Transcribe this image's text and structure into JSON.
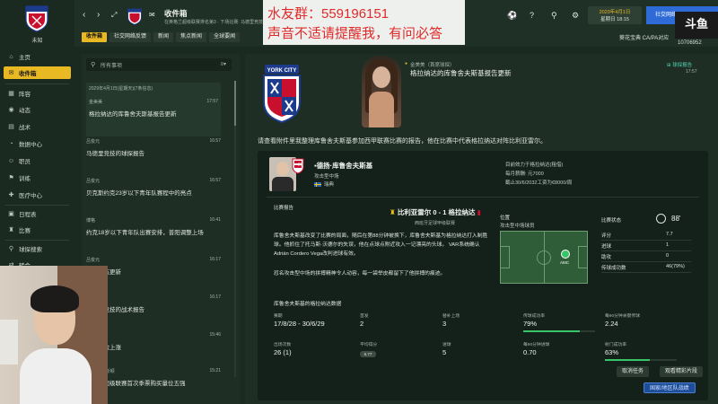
{
  "club": {
    "label": "未知",
    "badge_text": "YORK CITY"
  },
  "sidebar": {
    "items": [
      {
        "label": "主页",
        "icon": "home-icon",
        "glyph": "⌂"
      },
      {
        "label": "收件箱",
        "icon": "inbox-icon",
        "glyph": "✉"
      },
      {
        "label": "阵容",
        "icon": "squad-icon",
        "glyph": "▦"
      },
      {
        "label": "动态",
        "icon": "dynamics-icon",
        "glyph": "◉"
      },
      {
        "label": "战术",
        "icon": "tactics-icon",
        "glyph": "▤"
      },
      {
        "label": "数据中心",
        "icon": "data-hub-icon",
        "glyph": "◔"
      },
      {
        "label": "职员",
        "icon": "staff-icon",
        "glyph": "☺"
      },
      {
        "label": "训练",
        "icon": "training-icon",
        "glyph": "⚑"
      },
      {
        "label": "医疗中心",
        "icon": "medical-icon",
        "glyph": "✚"
      },
      {
        "label": "日程表",
        "icon": "schedule-icon",
        "glyph": "▣"
      },
      {
        "label": "比赛",
        "icon": "competitions-icon",
        "glyph": "♜"
      },
      {
        "label": "球探搜索",
        "icon": "scouting-icon",
        "glyph": "⚲"
      },
      {
        "label": "转会",
        "icon": "transfers-icon",
        "glyph": "⇄"
      }
    ]
  },
  "topbar": {
    "title": "收件箱",
    "subtitle": "在英格兰超级联赛排名第3 · 下场比赛: 马德里竞技(主场)",
    "tabs": [
      "收件箱",
      "社交网络反馈",
      "新闻",
      "焦点新闻",
      "全球要闻"
    ],
    "date_line1": "2029年4月1日",
    "date_line2": "星期日 18:15",
    "continue_label": "社交网络",
    "ad_text": "葵花宝典 CA/PA对应",
    "logo_text": "斗鱼",
    "room_id": "10706952"
  },
  "overlay": {
    "line1": "水友群：559196151",
    "line2": "声音不适请提醒我，有问必答"
  },
  "inbox": {
    "search_placeholder": "所有事项",
    "date_header": "2029年4月1日(星期天)(7条信息)",
    "messages": [
      {
        "from": "金美美",
        "time": "17:57",
        "subject": "格拉纳达的库鲁舍夫斯基报告更新"
      },
      {
        "from": "吕俊元",
        "time": "16:57",
        "subject": "马德里竞技的球探报告"
      },
      {
        "from": "吕俊元",
        "time": "16:57",
        "subject": "贝克斯约克23岁以下青年队赛程中的亮点"
      },
      {
        "from": "博格",
        "time": "16:41",
        "subject": "约克18岁以下青年队出赛安排，普阳调整上场"
      },
      {
        "from": "吕俊元",
        "time": "16:17",
        "subject": "球队动态更新"
      },
      {
        "from": "吕俊元",
        "time": "16:17",
        "subject": "马德里竞技的战术报告"
      },
      {
        "from": "吕俊元",
        "time": "15:46",
        "subject": "比赛奖金上涨"
      },
      {
        "from": "奥布里·费斯顿",
        "time": "15:21",
        "subject": "英格兰超级联赛首次季票购买量位五强"
      }
    ]
  },
  "message": {
    "sender": "金美美（首席球探）",
    "headline": "格拉纳达的库鲁舍夫斯基报告更新",
    "archive_label": "球探报告",
    "time": "17:57",
    "intro": "请查看附件里我整理库鲁舍夫斯基参加西甲联赛比赛的报告，他在比赛中代表格拉纳达对阵比利亚雷尔。",
    "player": {
      "name": "德扬·库鲁舍夫斯基",
      "number": "20",
      "position": "攻击型中场",
      "nationality": "瑞典"
    },
    "contract": {
      "line1": "目前效力于格拉纳达(租借)",
      "line2": "每月薪酬: 元7000",
      "line3": "截止30/6/2032工资为€8000/周"
    },
    "match_report_label": "比赛报告",
    "match_score": "比利亚雷尔 0 - 1 格拉纳达",
    "match_sub": "西班牙足球甲级联赛",
    "report_text": "库鲁舍夫斯基改变了比赛的局面，随后在第88分钟被换下，库鲁舍夫斯基为格拉纳达打入制胜球。他抓住了托马斯·沃德尔的失误，他在点球点附近攻入一记漂亮的头球。 VAR系统确认Adrián Cordero Vega改判进球有效。",
    "report_text2": "怼名攻击型中场的拼搏精神令人动容，每一袋举皮都留下了他拼搏的痕迹。",
    "position_label": "位置",
    "position_value": "攻击型中场球员",
    "pitch_marker": "AMC",
    "stats_header": "比赛状态",
    "rating": "88'",
    "stats": [
      {
        "label": "评分",
        "value": "7.7"
      },
      {
        "label": "进球",
        "value": "1"
      },
      {
        "label": "助攻",
        "value": "0"
      },
      {
        "label": "传球成功数",
        "value": "46(79%)"
      }
    ],
    "season_title": "库鲁舍夫斯基的格拉纳达数据",
    "season": [
      {
        "label": "赛期",
        "value": "17/8/28 - 30/6/29"
      },
      {
        "label": "首发",
        "value": "2"
      },
      {
        "label": "替补上场",
        "value": "3"
      },
      {
        "label": "传球成功率",
        "value": "79%",
        "pct": 0.79
      },
      {
        "label": "每90分钟关键传球",
        "value": "2.24"
      },
      {
        "label": "出场次数",
        "value": "26 (1)"
      },
      {
        "label": "平均得分",
        "value": "6.77"
      },
      {
        "label": "进球",
        "value": "5"
      },
      {
        "label": "每90分钟进球",
        "value": "0.70"
      },
      {
        "label": "射门成功率",
        "value": "63%",
        "pct": 0.63
      }
    ],
    "btn_cancel": "取消任务",
    "btn_view": "观看精彩片段",
    "btn_team": "国家/地区队战绩"
  }
}
